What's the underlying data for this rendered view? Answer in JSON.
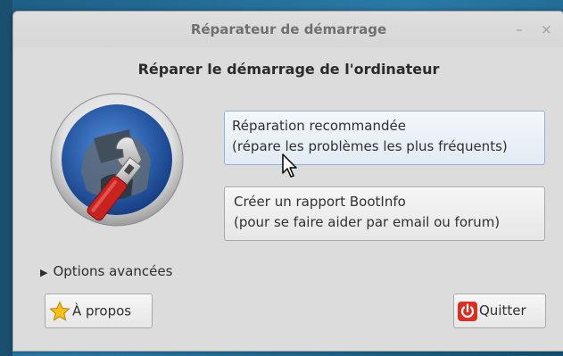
{
  "window": {
    "title": "Réparateur de démarrage",
    "minimize_glyph": "–",
    "close_glyph": "×"
  },
  "main": {
    "heading": "Réparer le démarrage de l'ordinateur",
    "logo_icon": "boot-repair-wrench-icon",
    "recommended_repair": {
      "line1": "Réparation recommandée",
      "line2": "(répare les problèmes les plus fréquents)"
    },
    "bootinfo_report": {
      "line1": "Créer un rapport BootInfo",
      "line2": "(pour se faire aider par email ou forum)"
    },
    "advanced_options": "Options avancées"
  },
  "footer": {
    "about_label": "À propos",
    "about_icon": "star-icon",
    "quit_label": "Quitter",
    "quit_icon": "power-icon"
  },
  "colors": {
    "window_bg": "#dcdcdc",
    "title_text": "#707070",
    "accent_blue": "#2a5db0",
    "wrench_red": "#c8231f",
    "power_red": "#d93025",
    "star_yellow": "#f6c21a"
  }
}
